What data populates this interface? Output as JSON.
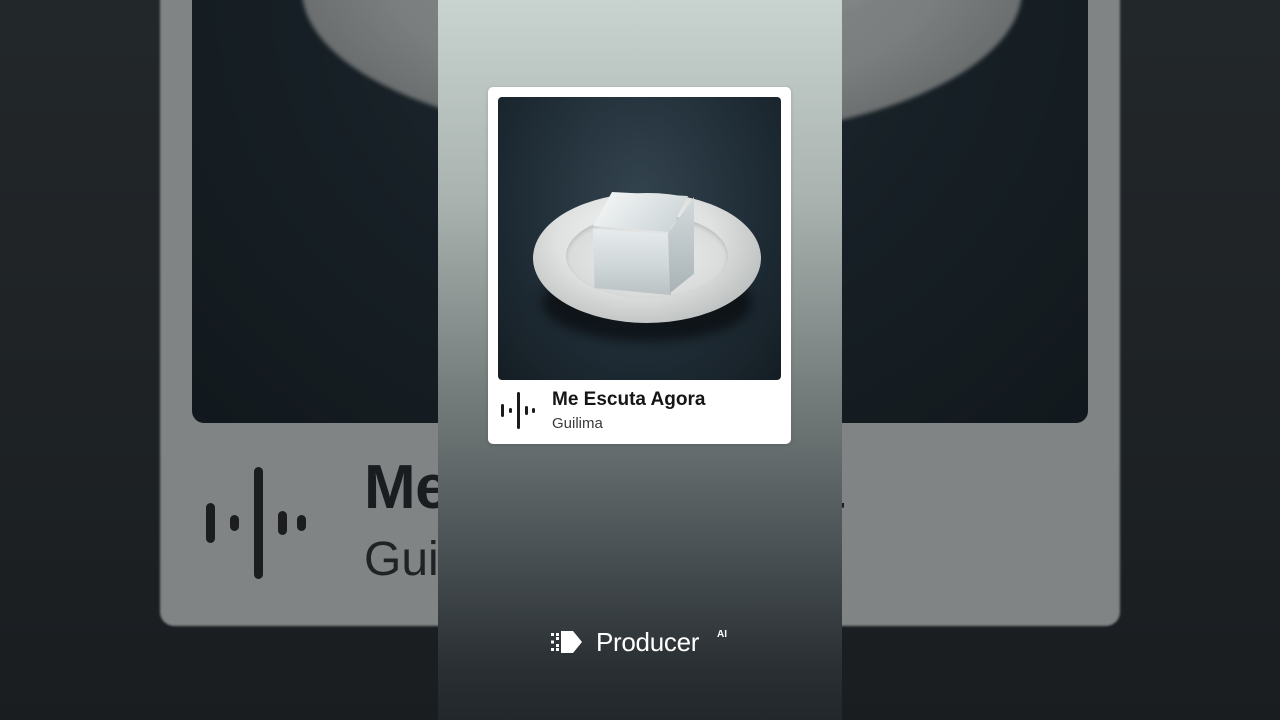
{
  "track": {
    "title": "Me Escuta Agora",
    "artist": "Guilima"
  },
  "background": {
    "title_visible_start": "Me",
    "title_visible_end": "a",
    "artist_visible_start": "Gui"
  },
  "brand": {
    "name": "Producer",
    "superscript": "AI"
  },
  "icons": {
    "waveform": "waveform-icon",
    "brand_logo": "producer-logo-icon"
  },
  "colors": {
    "card": "#ffffff",
    "panel_top": "#c9d3cf",
    "panel_bottom": "#22272b",
    "text_dark": "#151515",
    "brand_text": "#ffffff"
  }
}
